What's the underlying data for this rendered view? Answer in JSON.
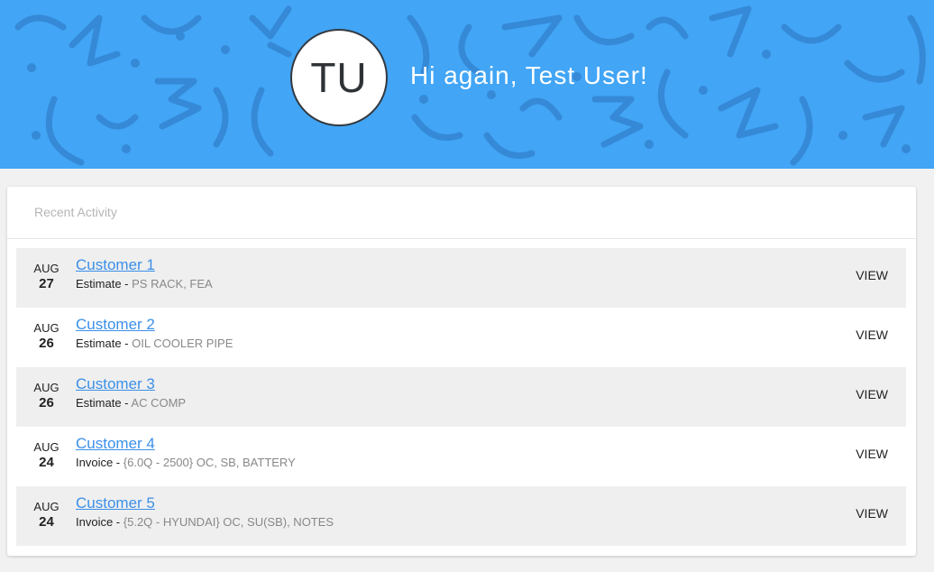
{
  "header": {
    "avatar_initials": "TU",
    "greeting": "Hi again, Test User!",
    "background_color": "#42a5f5",
    "pattern_color": "#3589d6"
  },
  "recent_activity": {
    "title": "Recent Activity",
    "view_label": "VIEW",
    "items": [
      {
        "month": "AUG",
        "day": "27",
        "customer": "Customer 1",
        "type": "Estimate -",
        "detail": "PS RACK, FEA"
      },
      {
        "month": "AUG",
        "day": "26",
        "customer": "Customer 2",
        "type": "Estimate -",
        "detail": "OIL COOLER PIPE"
      },
      {
        "month": "AUG",
        "day": "26",
        "customer": "Customer 3",
        "type": "Estimate -",
        "detail": "AC COMP"
      },
      {
        "month": "AUG",
        "day": "24",
        "customer": "Customer 4",
        "type": "Invoice -",
        "detail": "{6.0Q - 2500} OC, SB, BATTERY"
      },
      {
        "month": "AUG",
        "day": "24",
        "customer": "Customer 5",
        "type": "Invoice -",
        "detail": "{5.2Q - HYUNDAI} OC, SU(SB), NOTES"
      }
    ]
  }
}
